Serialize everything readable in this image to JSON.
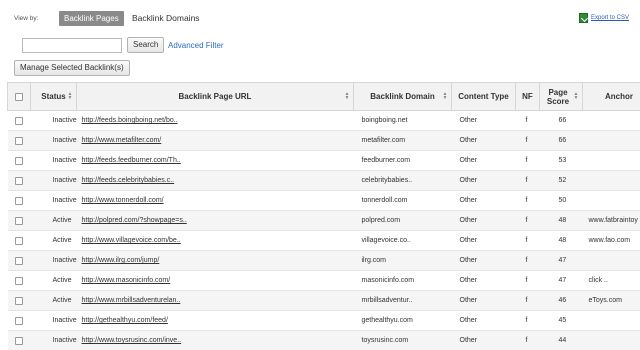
{
  "view_by": {
    "label": "View by:",
    "active_tab": "Backlink Pages",
    "other_tab": "Backlink Domains"
  },
  "export_label": "Export to CSV",
  "export_icon": "spreadsheet-icon",
  "search": {
    "placeholder": "",
    "value": "",
    "button": "Search"
  },
  "advanced_filter": "Advanced Filter",
  "manage_button": "Manage Selected Backlink(s)",
  "columns": [
    "Status",
    "Backlink Page URL",
    "Backlink Domain",
    "Content Type",
    "NF",
    "Page Score",
    "Anchor"
  ],
  "rows": [
    {
      "status": "Inactive",
      "url": "http://feeds.boingboing.net/bo..",
      "domain": "boingboing.net",
      "type": "Other",
      "nf": "f",
      "score": "66",
      "anchor": ""
    },
    {
      "status": "Inactive",
      "url": "http://www.metafilter.com/",
      "domain": "metafilter.com",
      "type": "Other",
      "nf": "f",
      "score": "66",
      "anchor": ""
    },
    {
      "status": "Inactive",
      "url": "http://feeds.feedburner.com/Th..",
      "domain": "feedburner.com",
      "type": "Other",
      "nf": "f",
      "score": "53",
      "anchor": ""
    },
    {
      "status": "Inactive",
      "url": "http://feeds.celebritybabies.c..",
      "domain": "celebritybabies..",
      "type": "Other",
      "nf": "f",
      "score": "52",
      "anchor": ""
    },
    {
      "status": "Inactive",
      "url": "http://www.tonnerdoll.com/",
      "domain": "tonnerdoll.com",
      "type": "Other",
      "nf": "f",
      "score": "50",
      "anchor": ""
    },
    {
      "status": "Active",
      "url": "http://polpred.com/?showpage=s..",
      "domain": "polpred.com",
      "type": "Other",
      "nf": "f",
      "score": "48",
      "anchor": "www.fatbraintoy"
    },
    {
      "status": "Active",
      "url": "http://www.villagevoice.com/be..",
      "domain": "villagevoice.co..",
      "type": "Other",
      "nf": "f",
      "score": "48",
      "anchor": "www.fao.com"
    },
    {
      "status": "Inactive",
      "url": "http://www.ilrg.com/jump/",
      "domain": "ilrg.com",
      "type": "Other",
      "nf": "f",
      "score": "47",
      "anchor": ""
    },
    {
      "status": "Active",
      "url": "http://www.masonicinfo.com/",
      "domain": "masonicinfo.com",
      "type": "Other",
      "nf": "f",
      "score": "47",
      "anchor": "click .."
    },
    {
      "status": "Active",
      "url": "http://www.mrbillsadventurelan..",
      "domain": "mrbillsadventur..",
      "type": "Other",
      "nf": "f",
      "score": "46",
      "anchor": "eToys.com"
    },
    {
      "status": "Inactive",
      "url": "http://gethealthyu.com/feed/",
      "domain": "gethealthyu.com",
      "type": "Other",
      "nf": "f",
      "score": "45",
      "anchor": ""
    },
    {
      "status": "Inactive",
      "url": "http://www.toysrusinc.com/inve..",
      "domain": "toysrusinc.com",
      "type": "Other",
      "nf": "f",
      "score": "44",
      "anchor": ""
    }
  ]
}
